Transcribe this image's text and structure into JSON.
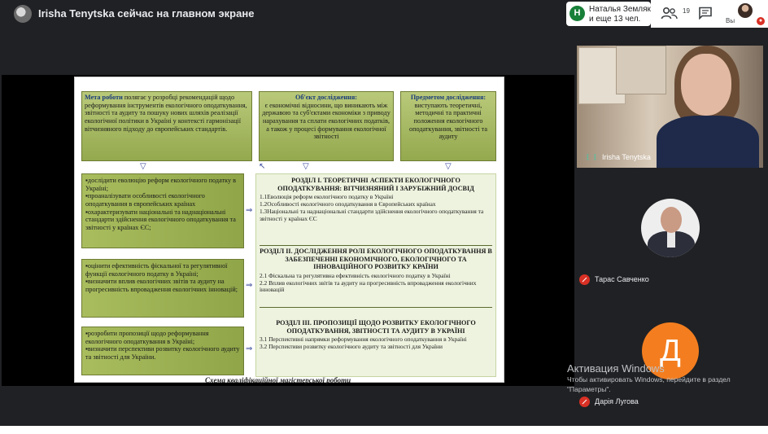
{
  "meeting": {
    "presenter_status": "Irisha Tenytska сейчас на главном экране"
  },
  "participants_card": {
    "initial": "Н",
    "line1": "Наталья Земляк",
    "line2": "и еще 13 чел."
  },
  "toolbar": {
    "people_count": "19",
    "self_label": "Вы"
  },
  "slide": {
    "top_boxes": [
      {
        "title": "Мета роботи",
        "text": " полягає у розробці рекомендацій щодо реформування інструментів екологічного оподаткування, звітності та аудиту та пошуку нових шляхів реалізації екологічної політики в Україні у контексті гармонізації вітчизняного підходу до європейських стандартів."
      },
      {
        "title": "Об'єкт дослідження:",
        "text": "є економічні відносини, що виникають між державою та суб'єктами економіки з приводу нарахування та сплати екологічних податків, а також у процесі формування екологічної звітності"
      },
      {
        "title": "Предметом дослідження:",
        "text": "виступають теоретичні, методичні та практичні положення екологічного оподаткування, звітності та аудиту"
      }
    ],
    "left_boxes": [
      [
        "▪дослідити еволюцію реформ екологічного податку в Україні;",
        "▪проаналізувати особливості екологічного оподаткування в європейських країнах",
        "▪охарактеризувати національні та наднаціональні стандарти здійснення екологічного оподаткування та звітності у країнах ЄС;"
      ],
      [
        "▪оцінити ефективність фіскальної та регулятивної функції екологічного податку в Україні;",
        "▪визначити вплив екологічних звітів та аудиту на прогресивність впровадження екологічних інновацій;"
      ],
      [
        "▪розробити пропозиції щодо реформування екологічного оподаткування в Україні;",
        "▪визначити перспективи розвитку екологічного аудиту та звітності для України."
      ]
    ],
    "sections": [
      {
        "heading": "РОЗДІЛ І. ТЕОРЕТИЧНІ АСПЕКТИ ЕКОЛОГІЧНОГО ОПОДАТКУВАННЯ: ВІТЧИЗНЯНИЙ І ЗАРУБІЖНИЙ ДОСВІД",
        "items": [
          "1.1Еволюція реформ екологічного податку в Україні",
          "1.2Особливості екологічного оподаткування в Європейських країнах",
          "1.3Національні та наднаціональні стандарти здійснення екологічного оподаткування та звітності у країнах ЄС"
        ]
      },
      {
        "heading": "РОЗДІЛ ІІ. ДОСЛІДЖЕННЯ РОЛІ ЕКОЛОГІЧНОГО ОПОДАТКУВАННЯ В ЗАБЕЗПЕЧЕННІ ЕКОНОМІЧНОГО, ЕКОЛОГІЧНОГО ТА ІННОВАЦІЙНОГО РОЗВИТКУ КРАЇНИ",
        "items": [
          "2.1 Фіскальна та регулятивна ефективність екологічного податку в Україні",
          "2.2 Вплив екологічних звітів та аудиту на прогресивність впровадження екологічних інновацій"
        ]
      },
      {
        "heading": "РОЗДІЛ ІІІ. ПРОПОЗИЦІЇ ЩОДО РОЗВИТКУ ЕКОЛОГІЧНОГО ОПОДАТКУВАННЯ, ЗВІТНОСТІ ТА АУДИТУ В УКРАЇНІ",
        "items": [
          "3.1 Перспективні напрямки реформування екологічного оподаткування в Україні",
          "3.2 Перспективи розвитку екологічного аудиту та звітності для України"
        ]
      }
    ],
    "caption": "Схема кваліфікаційної магістерської роботи"
  },
  "tiles": {
    "main_name": "Irisha Tenytska",
    "p2_name": "Тарас Савченко",
    "p3_initial": "Д",
    "p3_name": "Дарія Лугова"
  },
  "activation": {
    "title": "Активация Windows",
    "line1": "Чтобы активировать Windows, перейдите в раздел",
    "line2": "\"Параметры\"."
  },
  "colors": {
    "meet_bg": "#202124",
    "mute_red": "#d93025",
    "avatar_orange": "#f47e1f",
    "box_green": "#94a94e",
    "section_bg": "#eef3df"
  }
}
